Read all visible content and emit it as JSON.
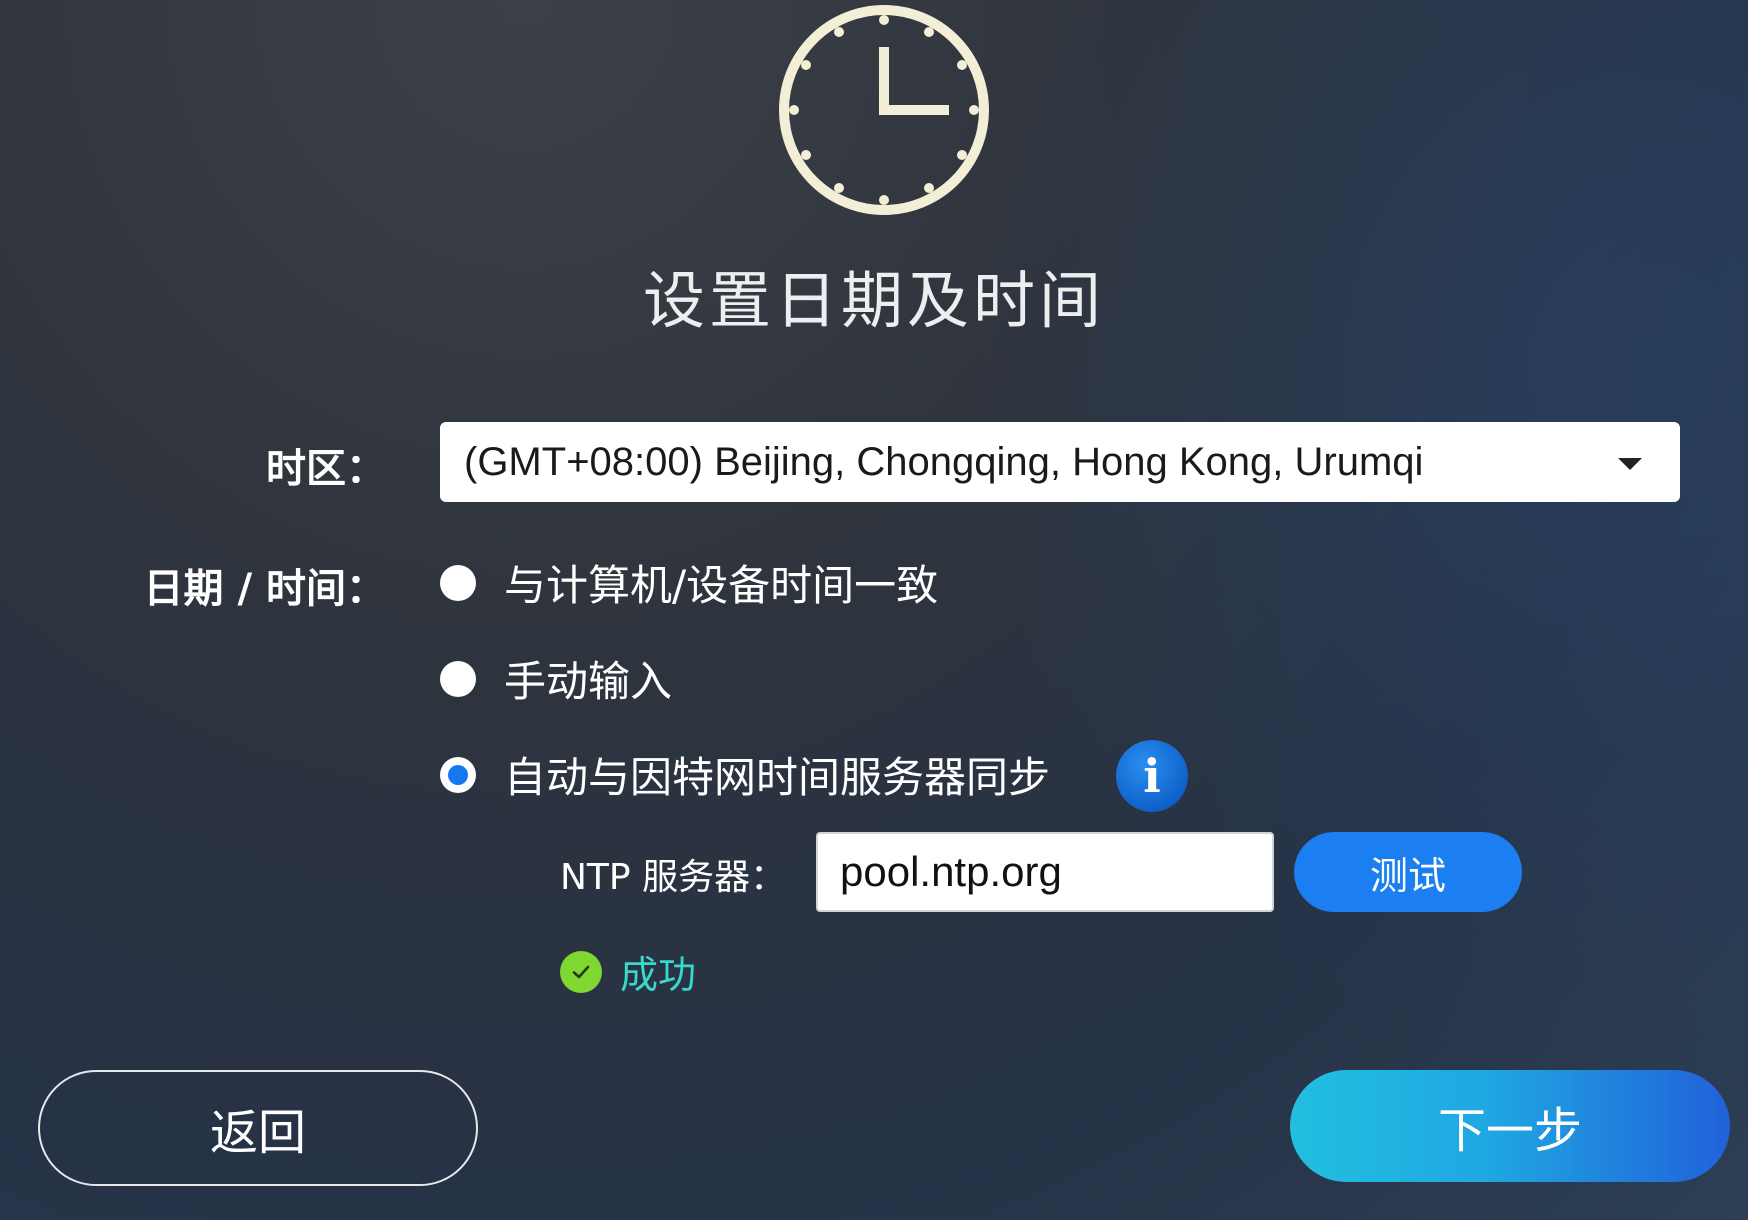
{
  "title": "设置日期及时间",
  "colors": {
    "accent": "#1b7ff2",
    "success_icon": "#7fd832",
    "success_text": "#39d7cc",
    "clock": "#f2efd6"
  },
  "icons": {
    "header": "clock-icon",
    "dropdown": "chevron-down-icon",
    "info": "info-icon",
    "status": "check-circle-icon"
  },
  "timezone": {
    "label": "时区：",
    "value": "(GMT+08:00) Beijing, Chongqing, Hong Kong, Urumqi"
  },
  "datetime": {
    "label": "日期 / 时间：",
    "options": [
      {
        "label": "与计算机/设备时间一致",
        "selected": false
      },
      {
        "label": "手动输入",
        "selected": false
      },
      {
        "label": "自动与因特网时间服务器同步",
        "selected": true
      }
    ],
    "info_glyph": "i"
  },
  "ntp": {
    "label": "NTP 服务器：",
    "value": "pool.ntp.org",
    "test_label": "测试",
    "status": "成功"
  },
  "footer": {
    "back_label": "返回",
    "next_label": "下一步"
  }
}
